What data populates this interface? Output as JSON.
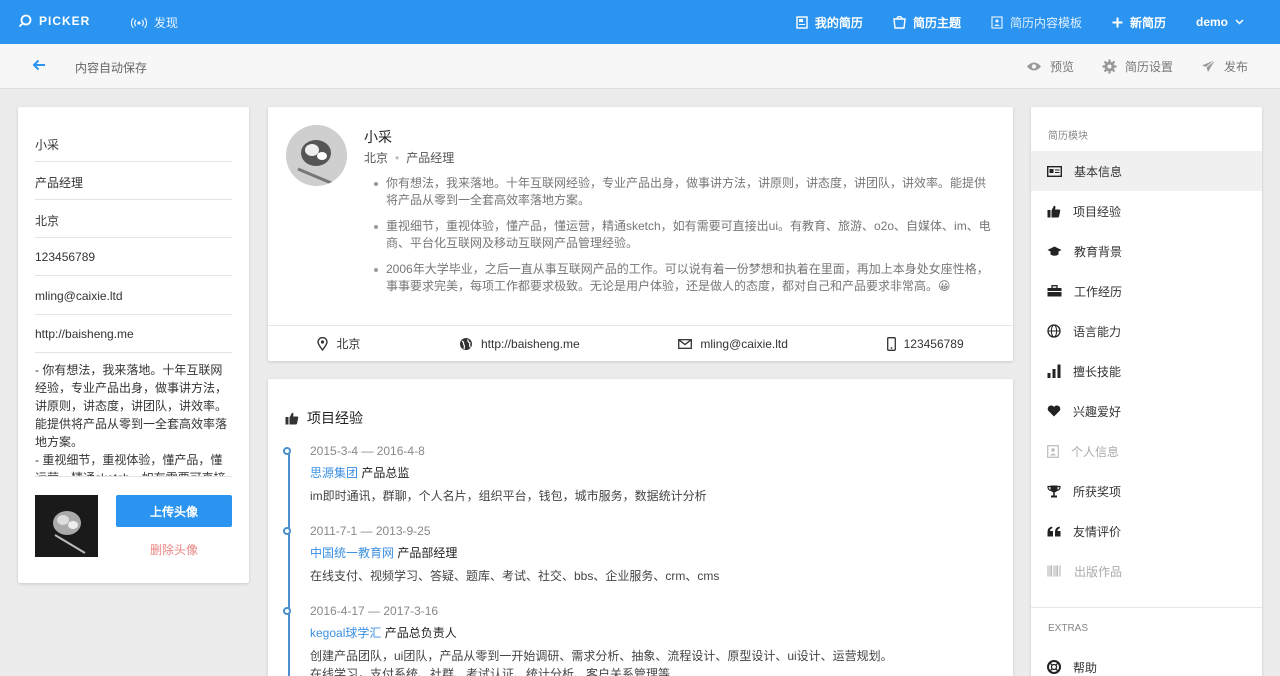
{
  "topbar": {
    "logo": "PICKER",
    "discover": "发现",
    "nav": [
      {
        "label": "我的简历",
        "icon": "resume-icon"
      },
      {
        "label": "简历主题",
        "icon": "theme-icon"
      },
      {
        "label": "简历内容模板",
        "icon": "template-icon"
      },
      {
        "label": "新简历",
        "icon": "plus-icon"
      },
      {
        "label": "demo",
        "icon": "chevron-down-icon"
      }
    ]
  },
  "subbar": {
    "autosave": "内容自动保存",
    "actions": [
      {
        "label": "预览",
        "icon": "eye-icon"
      },
      {
        "label": "简历设置",
        "icon": "gear-icon"
      },
      {
        "label": "发布",
        "icon": "send-icon"
      }
    ]
  },
  "form": {
    "name": "小采",
    "title": "产品经理",
    "city": "北京",
    "phone": "123456789",
    "email": "mling@caixie.ltd",
    "website": "http://baisheng.me",
    "bio": "- 你有想法，我来落地。十年互联网经验，专业产品出身，做事讲方法，讲原则，讲态度，讲团队，讲效率。能提供将产品从零到一全套高效率落地方案。\n- 重视细节，重视体验，懂产品，懂运营，精通sketch，如有需要可直接出ui。",
    "upload_label": "上传头像",
    "delete_label": "删除头像"
  },
  "profile": {
    "name": "小采",
    "city": "北京",
    "title": "产品经理",
    "bullets": [
      "你有想法，我来落地。十年互联网经验，专业产品出身，做事讲方法，讲原则，讲态度，讲团队，讲效率。能提供将产品从零到一全套高效率落地方案。",
      "重视细节，重视体验，懂产品，懂运营，精通sketch，如有需要可直接出ui。有教育、旅游、o2o、自媒体、im、电商、平台化互联网及移动互联网产品管理经验。",
      "2006年大学毕业，之后一直从事互联网产品的工作。可以说有着一份梦想和执着在里面，再加上本身处女座性格，事事要求完美，每项工作都要求极致。无论是用户体验，还是做人的态度，都对自己和产品要求非常高。😀"
    ],
    "contact": {
      "city": "北京",
      "website": "http://baisheng.me",
      "email": "mling@caixie.ltd",
      "phone": "123456789"
    }
  },
  "projects": {
    "title": "项目经验",
    "entries": [
      {
        "date": "2015-3-4 — 2016-4-8",
        "company": "思源集团",
        "role": "产品总监",
        "desc": "im即时通讯，群聊，个人名片，组织平台，钱包，城市服务，数据统计分析"
      },
      {
        "date": "2011-7-1 — 2013-9-25",
        "company": "中国统一教育网",
        "role": "产品部经理",
        "desc": "在线支付、视频学习、答疑、题库、考试、社交、bbs、企业服务、crm、cms"
      },
      {
        "date": "2016-4-17 — 2017-3-16",
        "company": "kegoal球学汇",
        "role": "产品总负责人",
        "desc": "创建产品团队，ui团队，产品从零到一开始调研、需求分析、抽象、流程设计、原型设计、ui设计、运营规划。",
        "desc2": "在线学习，支付系统、社群、考试认证、统计分析、客户关系管理等"
      }
    ]
  },
  "modules": {
    "heading": "简历模块",
    "items": [
      {
        "label": "基本信息",
        "icon": "id-card-icon"
      },
      {
        "label": "项目经验",
        "icon": "thumbs-up-icon"
      },
      {
        "label": "教育背景",
        "icon": "graduation-cap-icon"
      },
      {
        "label": "工作经历",
        "icon": "briefcase-icon"
      },
      {
        "label": "语言能力",
        "icon": "globe-icon"
      },
      {
        "label": "擅长技能",
        "icon": "bar-chart-icon"
      },
      {
        "label": "兴趣爱好",
        "icon": "heart-icon"
      },
      {
        "label": "个人信息",
        "icon": "user-card-icon"
      },
      {
        "label": "所获奖项",
        "icon": "trophy-icon"
      },
      {
        "label": "友情评价",
        "icon": "quote-icon"
      },
      {
        "label": "出版作品",
        "icon": "barcode-icon"
      }
    ],
    "extras_heading": "EXTRAS",
    "help": "帮助"
  }
}
